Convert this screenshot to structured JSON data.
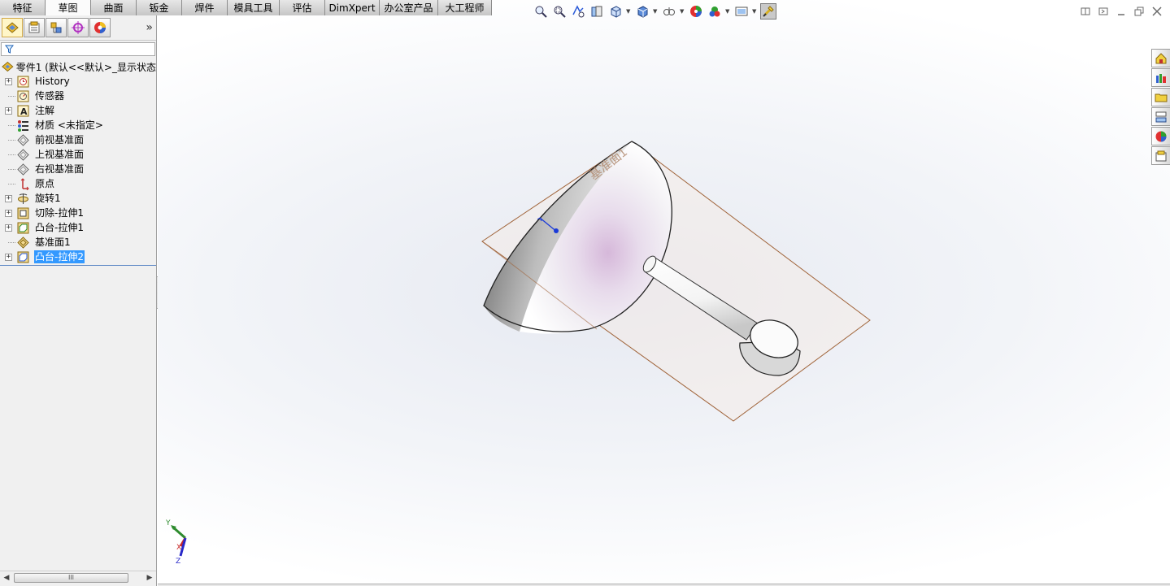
{
  "tabs": [
    "特征",
    "草图",
    "曲面",
    "钣金",
    "焊件",
    "模具工具",
    "评估",
    "DimXpert",
    "办公室产品",
    "大工程师"
  ],
  "active_tab_index": 1,
  "left_toolbar": [
    "featuremanager-tree-icon",
    "propertymanager-icon",
    "configurationmanager-icon",
    "dimxpertmanager-icon",
    "displaymanager-icon"
  ],
  "left_toolbar_more": "»",
  "feature_tree": {
    "root_label": "零件1 (默认<<默认>_显示状态",
    "nodes": [
      {
        "label": "History",
        "expandable": true,
        "icon": "history-icon"
      },
      {
        "label": "传感器",
        "expandable": false,
        "icon": "sensor-icon"
      },
      {
        "label": "注解",
        "expandable": true,
        "icon": "annotation-icon"
      },
      {
        "label": "材质 <未指定>",
        "expandable": false,
        "icon": "material-icon"
      },
      {
        "label": "前视基准面",
        "expandable": false,
        "icon": "plane-icon"
      },
      {
        "label": "上视基准面",
        "expandable": false,
        "icon": "plane-icon"
      },
      {
        "label": "右视基准面",
        "expandable": false,
        "icon": "plane-icon"
      },
      {
        "label": "原点",
        "expandable": false,
        "icon": "origin-icon"
      },
      {
        "label": "旋转1",
        "expandable": true,
        "icon": "revolve-icon"
      },
      {
        "label": "切除-拉伸1",
        "expandable": true,
        "icon": "cut-extrude-icon"
      },
      {
        "label": "凸台-拉伸1",
        "expandable": true,
        "icon": "boss-extrude-icon"
      },
      {
        "label": "基准面1",
        "expandable": false,
        "icon": "plane-icon"
      },
      {
        "label": "凸台-拉伸2",
        "expandable": true,
        "icon": "boss-extrude-icon",
        "selected": true
      }
    ]
  },
  "scrollbar_grip": "III",
  "heads_up_toolbar": [
    "zoom-to-fit-icon",
    "zoom-to-area-icon",
    "previous-view-icon",
    "section-view-icon",
    "view-orientation-icon",
    "display-style-icon",
    "hide-show-items-icon",
    "edit-appearance-icon",
    "apply-scene-icon",
    "view-settings-icon",
    "rebuild-icon"
  ],
  "window_controls": [
    "restore-icon",
    "tile-icon",
    "minimize-icon",
    "maximize-icon",
    "close-icon"
  ],
  "task_pane": [
    "solidworks-resources-icon",
    "design-library-icon",
    "file-explorer-icon",
    "view-palette-icon",
    "appearances-icon",
    "custom-properties-icon"
  ],
  "viewport": {
    "plane_label": "基准面1",
    "triad_labels": {
      "y": "Y",
      "x": "X",
      "z": "Z"
    }
  },
  "colors": {
    "selection": "#3399ff",
    "plane_edge": "#a0643a",
    "triad_y": "#2e8b2e",
    "triad_x": "#c82828",
    "triad_z": "#2828c8"
  }
}
